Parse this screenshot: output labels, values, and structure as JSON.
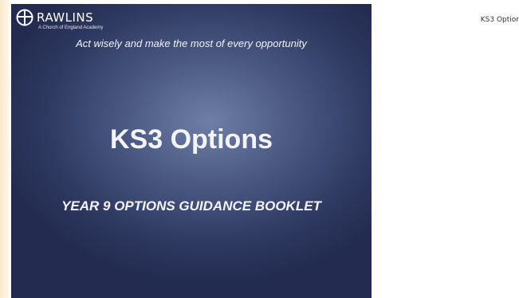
{
  "logo": {
    "name": "RAWLINS",
    "subtitle": "A Church of England Academy"
  },
  "slide": {
    "motto": "Act wisely and make the most of every opportunity",
    "title": "KS3 Options",
    "subtitle": "YEAR 9 OPTIONS GUIDANCE BOOKLET"
  },
  "page_header": {
    "label": "KS3 Optior"
  },
  "colors": {
    "slide_dark": "#232c50",
    "slide_light": "#6e7fa7",
    "text": "#ffffff",
    "edge_strip": "#fbe9cf"
  }
}
